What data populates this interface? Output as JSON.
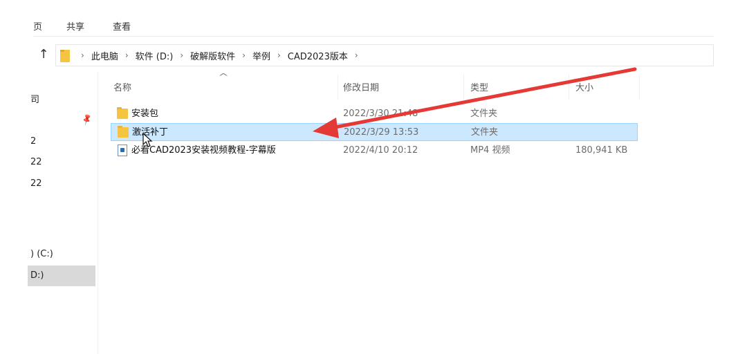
{
  "ribbon": {
    "tab_partial": "页",
    "share": "共享",
    "view": "查看"
  },
  "address": {
    "crumbs": [
      "此电脑",
      "软件 (D:)",
      "破解版软件",
      "举例",
      "CAD2023版本"
    ],
    "separator": "›"
  },
  "navigation": {
    "items": [
      "司",
      "2",
      "22",
      "22",
      ") (C:)",
      "D:)"
    ],
    "selected_index": 5
  },
  "columns": {
    "name": "名称",
    "date": "修改日期",
    "type": "类型",
    "size": "大小"
  },
  "files": [
    {
      "name": "安装包",
      "date": "2022/3/30 21:48",
      "type": "文件夹",
      "size": "",
      "icon": "folder-icon"
    },
    {
      "name": "激活补丁",
      "date": "2022/3/29 13:53",
      "type": "文件夹",
      "size": "",
      "icon": "folder-icon",
      "selected": true
    },
    {
      "name": "必看CAD2023安装视频教程-字幕版",
      "date": "2022/4/10 20:12",
      "type": "MP4 视频",
      "size": "180,941 KB",
      "icon": "video-file-icon"
    }
  ],
  "colors": {
    "selection_bg": "#cce8ff",
    "selection_border": "#99d1ff",
    "annotation_arrow": "#e53935"
  }
}
